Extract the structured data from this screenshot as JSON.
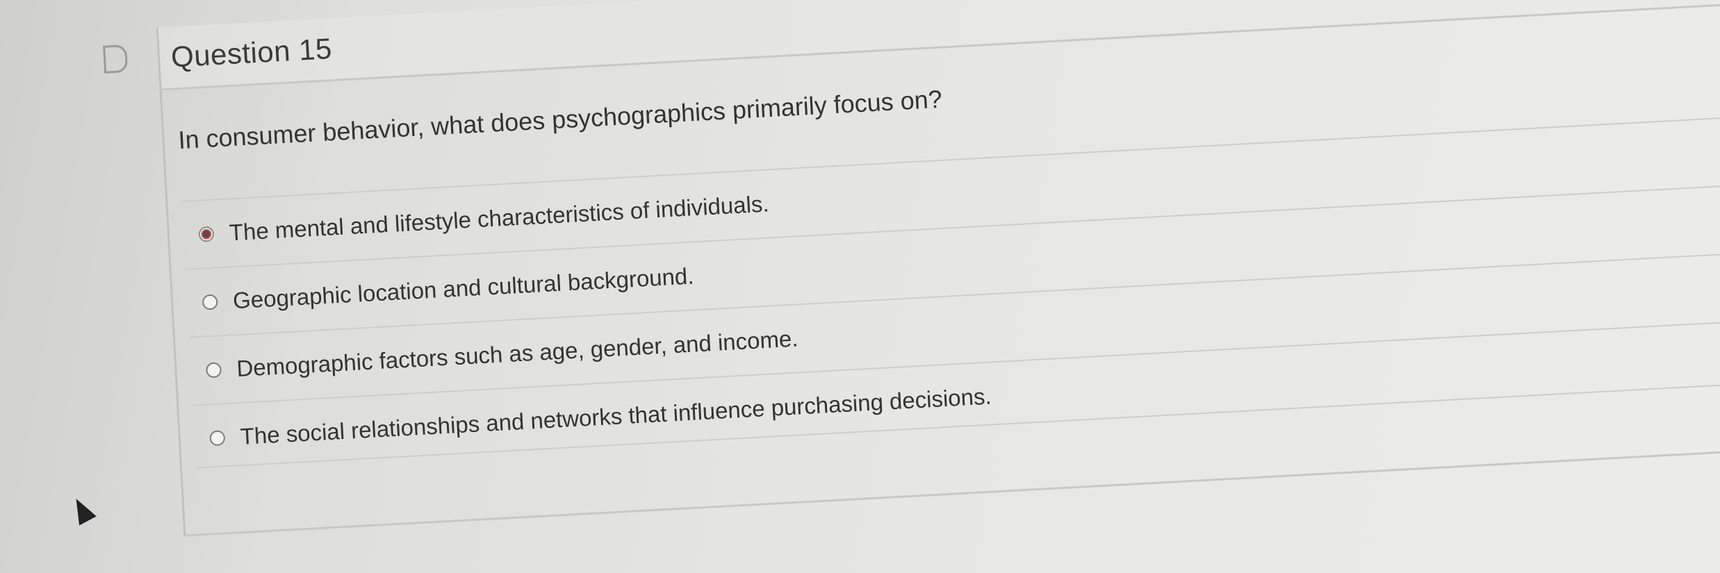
{
  "question": {
    "title": "Question 15",
    "prompt": "In consumer behavior, what does psychographics primarily focus on?",
    "options": [
      {
        "label": "The mental and lifestyle characteristics of individuals.",
        "selected": true
      },
      {
        "label": "Geographic location and cultural background.",
        "selected": false
      },
      {
        "label": "Demographic factors such as age, gender, and income.",
        "selected": false
      },
      {
        "label": "The social relationships and networks that influence purchasing decisions.",
        "selected": false
      }
    ]
  },
  "icons": {
    "flag": "flag-icon",
    "cursor": "mouse-pointer-icon"
  }
}
